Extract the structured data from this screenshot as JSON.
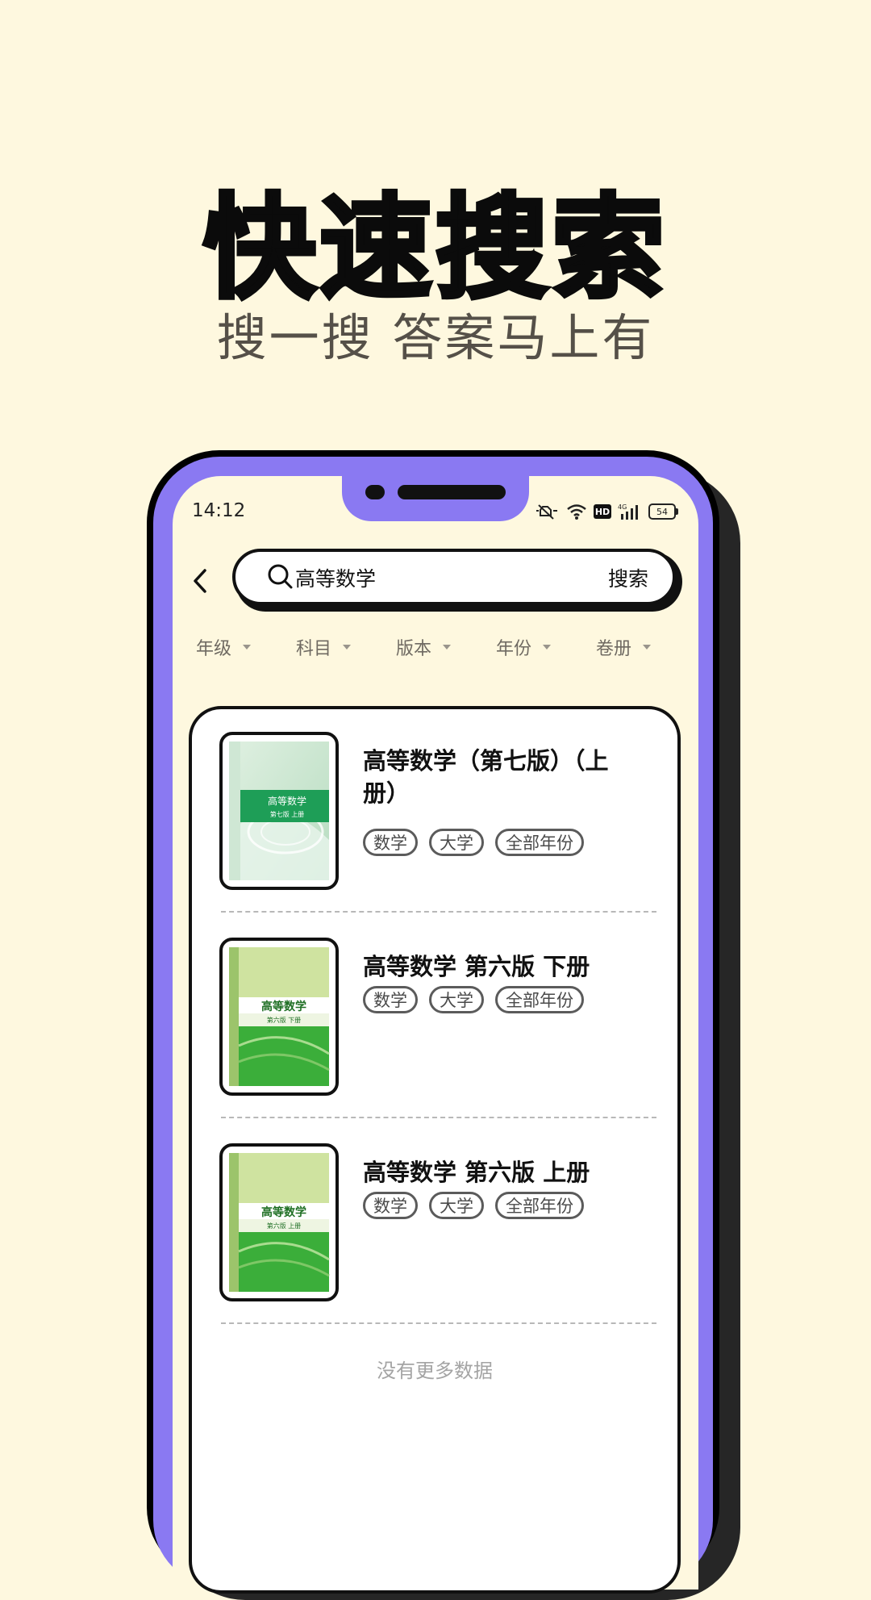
{
  "promo": {
    "headline": "快速搜索",
    "subline": "搜一搜 答案马上有"
  },
  "status_bar": {
    "time": "14:12",
    "battery": "54",
    "network": "4G",
    "hd": "HD"
  },
  "search": {
    "query": "高等数学",
    "submit_label": "搜索"
  },
  "filters": [
    {
      "label": "年级"
    },
    {
      "label": "科目"
    },
    {
      "label": "版本"
    },
    {
      "label": "年份"
    },
    {
      "label": "卷册"
    }
  ],
  "results": [
    {
      "title": "高等数学（第七版）（上册）",
      "tags": [
        "数学",
        "大学",
        "全部年份"
      ],
      "cover": {
        "title": "高等数学",
        "subtitle": "第七版 上册",
        "color": "#1E9E57"
      }
    },
    {
      "title": "高等数学 第六版 下册",
      "tags": [
        "数学",
        "大学",
        "全部年份"
      ],
      "cover": {
        "title": "高等数学",
        "subtitle": "第六版 下册",
        "color": "#3BAE3A"
      }
    },
    {
      "title": "高等数学 第六版 上册",
      "tags": [
        "数学",
        "大学",
        "全部年份"
      ],
      "cover": {
        "title": "高等数学",
        "subtitle": "第六版 上册",
        "color": "#3BAE3A"
      }
    }
  ],
  "footer_text": "没有更多数据",
  "colors": {
    "background": "#FEF8DF",
    "phone_accent": "#8A79F2",
    "cover_green": "#3BAE3A"
  }
}
